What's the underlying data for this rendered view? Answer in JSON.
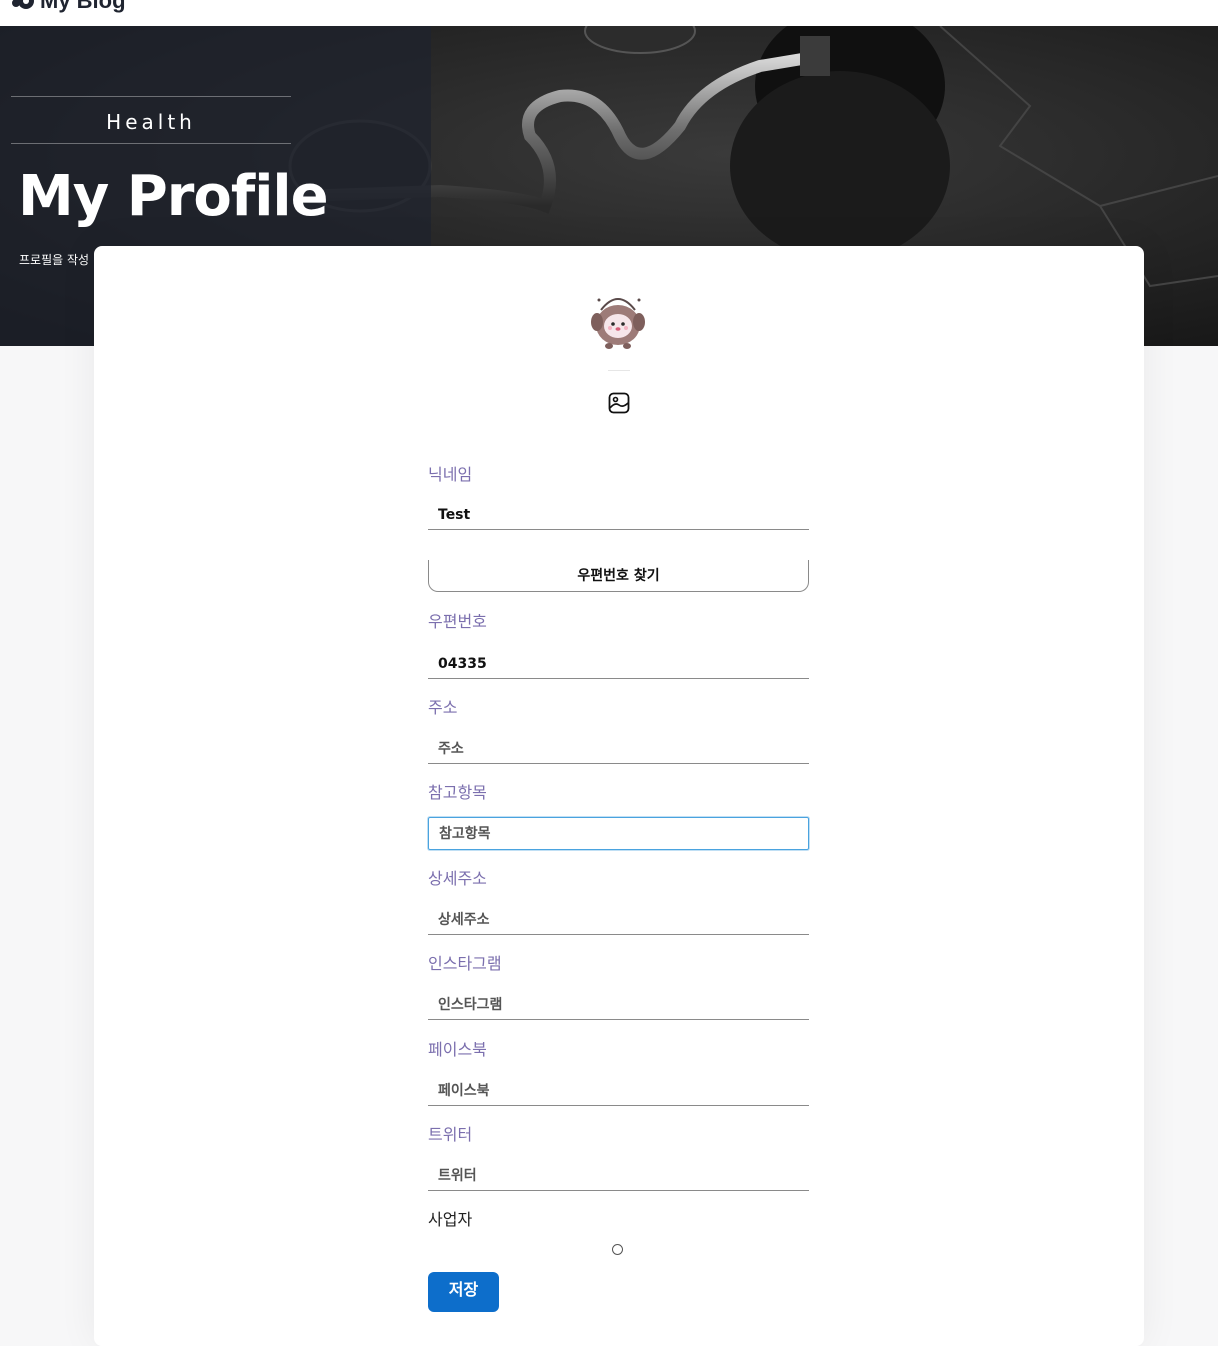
{
  "nav": {
    "brand": "My Blog"
  },
  "hero": {
    "category": "Health",
    "title": "My Profile",
    "subtitle": "프로필을 작성"
  },
  "profile": {
    "image_icon": "image-icon"
  },
  "form": {
    "nickname": {
      "label": "닉네임",
      "value": "Test",
      "placeholder": ""
    },
    "postcode_button": "우편번호 찾기",
    "postcode": {
      "label": "우편번호",
      "value": "04335",
      "placeholder": ""
    },
    "address": {
      "label": "주소",
      "value": "",
      "placeholder": "주소"
    },
    "reference": {
      "label": "참고항목",
      "value": "",
      "placeholder": "참고항목"
    },
    "detail_address": {
      "label": "상세주소",
      "value": "",
      "placeholder": "상세주소"
    },
    "instagram": {
      "label": "인스타그램",
      "value": "",
      "placeholder": "인스타그램"
    },
    "facebook": {
      "label": "페이스북",
      "value": "",
      "placeholder": "페이스북"
    },
    "twitter": {
      "label": "트위터",
      "value": "",
      "placeholder": "트위터"
    },
    "business": {
      "label": "사업자",
      "checked": false
    },
    "save_button": "저장"
  },
  "colors": {
    "label": "#7b6fae",
    "primary_button": "#0d6ecb",
    "focus_border": "#4aa3df"
  }
}
